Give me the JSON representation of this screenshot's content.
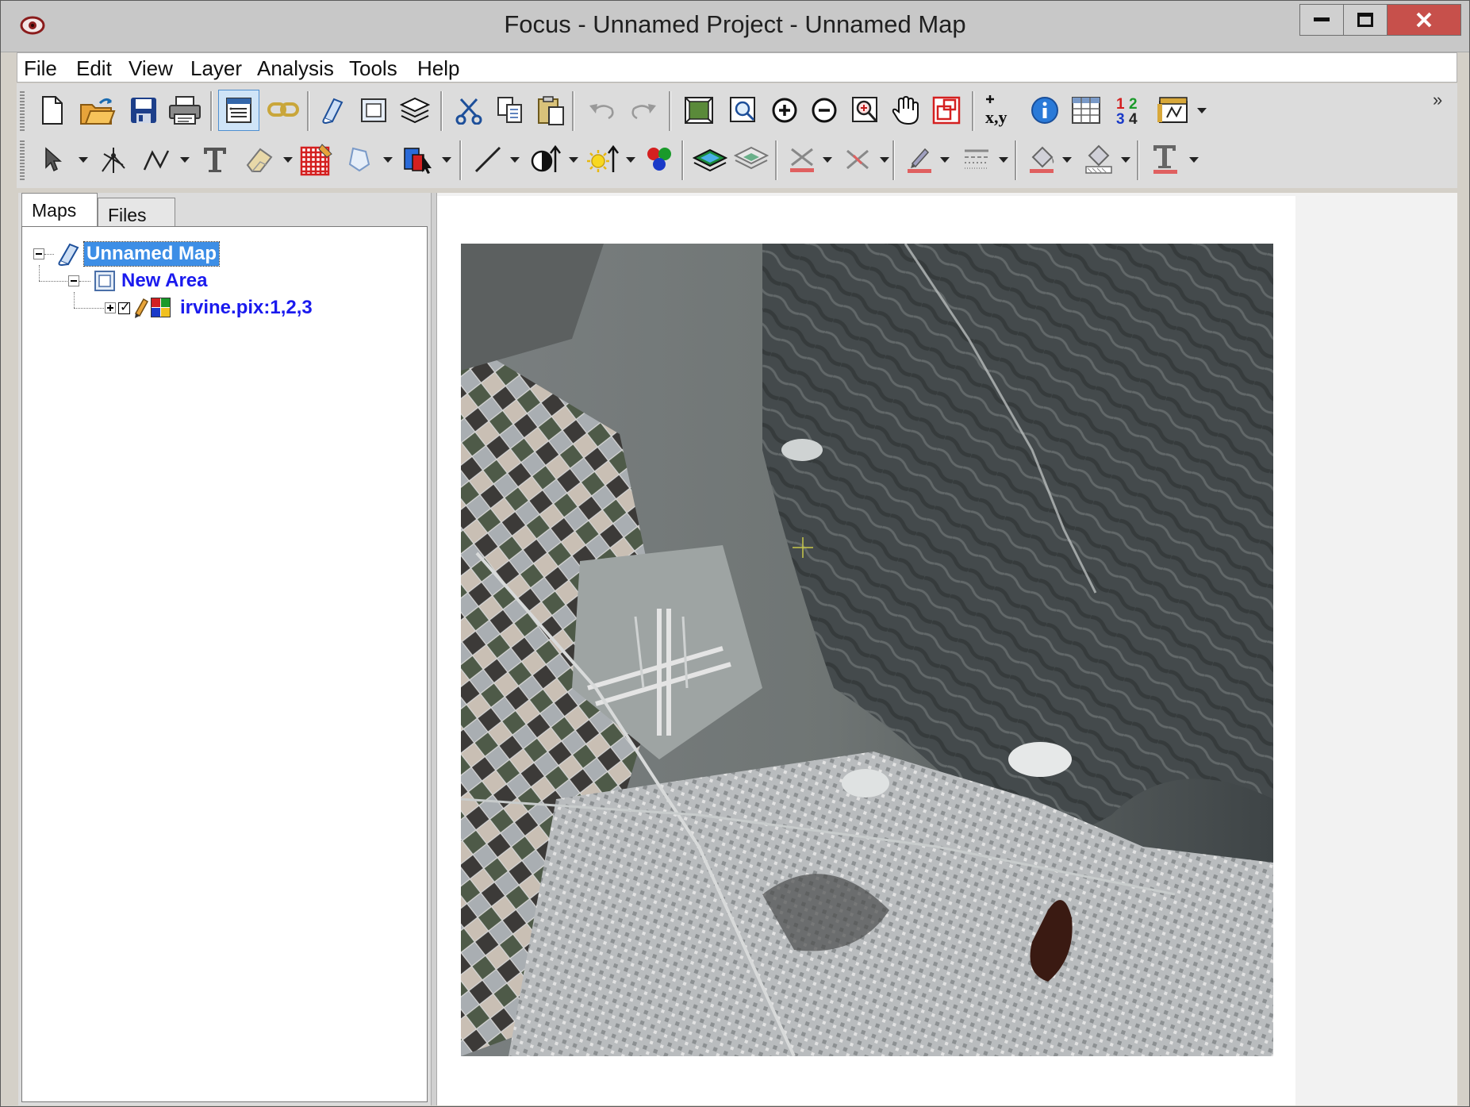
{
  "window": {
    "title": "Focus - Unnamed Project - Unnamed Map",
    "controls": {
      "minimize": "minimize",
      "maximize": "maximize",
      "close": "close"
    }
  },
  "menu": {
    "items": [
      "File",
      "Edit",
      "View",
      "Layer",
      "Analysis",
      "Tools",
      "Help"
    ]
  },
  "toolbar": {
    "row1": [
      "new",
      "open",
      "save",
      "print",
      "map-properties",
      "link",
      "new-map",
      "new-area",
      "layers",
      "cut",
      "copy",
      "paste",
      "undo",
      "redo",
      "zoom-to-area",
      "zoom-to-layer",
      "zoom-in",
      "zoom-out",
      "zoom-box",
      "pan",
      "overview",
      "coordinates",
      "info",
      "attribute-table",
      "band-selector",
      "legend"
    ],
    "row2": [
      "select",
      "edit-vertices",
      "polyline",
      "text",
      "eraser",
      "raster-paint",
      "polygon",
      "fill-tool",
      "line",
      "contrast",
      "brightness",
      "rgb-mapper",
      "layer-up",
      "layer-down",
      "crosses",
      "x-marks",
      "pen-color",
      "line-style",
      "fill-color",
      "fill-pattern",
      "text-color"
    ],
    "coordinates_label": "x,y",
    "band_numbers": [
      "1",
      "2",
      "3",
      "4"
    ],
    "more_glyph": "»"
  },
  "left_panel": {
    "tabs": [
      "Maps",
      "Files"
    ],
    "active_tab": "Maps",
    "tree": {
      "map": "Unnamed Map",
      "area": "New Area",
      "layer": "irvine.pix:1,2,3"
    }
  },
  "map_view": {
    "image_description": "irvine.pix",
    "cursor": "crosshair"
  },
  "colors": {
    "selection": "#3d8ee6",
    "tree_text": "#1a1aee",
    "close_button": "#c7504b"
  }
}
